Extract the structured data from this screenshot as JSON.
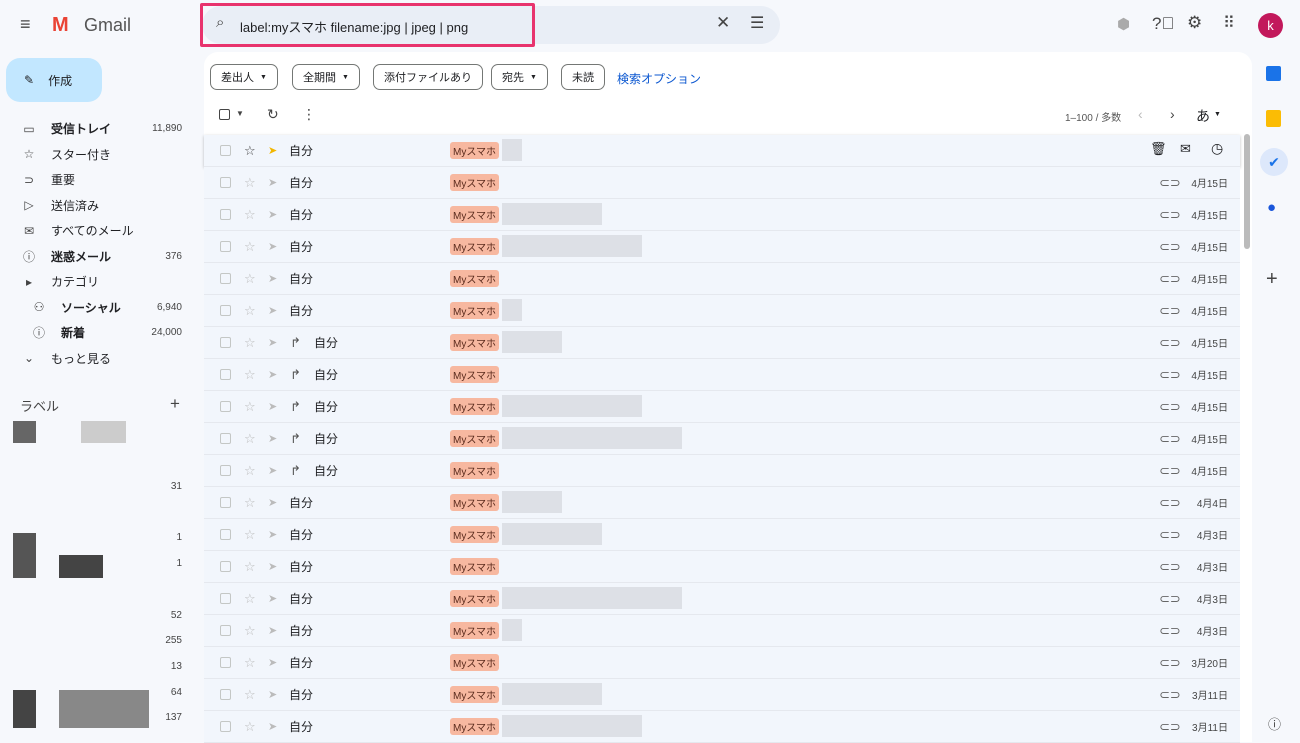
{
  "app": {
    "name": "Gmail",
    "avatar": "k"
  },
  "search": {
    "query": "label:myスマホ filename:jpg | jpeg | png"
  },
  "compose": "作成",
  "nav": [
    {
      "icon": "inbox-icon",
      "glyph": "▭",
      "label": "受信トレイ",
      "count": "11,890",
      "bold": true
    },
    {
      "icon": "star-icon",
      "glyph": "☆",
      "label": "スター付き",
      "count": ""
    },
    {
      "icon": "important-icon",
      "glyph": "⊃",
      "label": "重要",
      "count": ""
    },
    {
      "icon": "sent-icon",
      "glyph": "▷",
      "label": "送信済み",
      "count": ""
    },
    {
      "icon": "all-mail-icon",
      "glyph": "✉",
      "label": "すべてのメール",
      "count": ""
    },
    {
      "icon": "spam-icon",
      "glyph": "ⓘ",
      "label": "迷惑メール",
      "count": "376",
      "bold": true
    },
    {
      "icon": "category-icon",
      "glyph": "▸",
      "label": "カテゴリ",
      "count": ""
    },
    {
      "icon": "social-icon",
      "glyph": "⚇",
      "label": "ソーシャル",
      "count": "6,940",
      "bold": true,
      "indent": true
    },
    {
      "icon": "updates-icon",
      "glyph": "ⓘ",
      "label": "新着",
      "count": "24,000",
      "bold": true,
      "indent": true
    },
    {
      "icon": "chevron-down-icon",
      "glyph": "⌄",
      "label": "もっと見る",
      "count": ""
    }
  ],
  "labels": {
    "title": "ラベル",
    "counts": [
      "31",
      "1",
      "1",
      "52",
      "255",
      "13",
      "64",
      "137"
    ]
  },
  "filters": [
    "差出人",
    "全期間",
    "添付ファイルあり",
    "宛先",
    "未読"
  ],
  "search_options": "検索オプション",
  "pagination": "1–100 / 多数",
  "input_tool": "あ",
  "rows": [
    {
      "sender": "自分",
      "tag": "Myスマホ",
      "date": "",
      "fw": false,
      "hover": true
    },
    {
      "sender": "自分",
      "tag": "Myスマホ",
      "date": "4月15日",
      "fw": false
    },
    {
      "sender": "自分",
      "tag": "Myスマホ",
      "date": "4月15日",
      "fw": false
    },
    {
      "sender": "自分",
      "tag": "Myスマホ",
      "date": "4月15日",
      "fw": false
    },
    {
      "sender": "自分",
      "tag": "Myスマホ",
      "date": "4月15日",
      "fw": false
    },
    {
      "sender": "自分",
      "tag": "Myスマホ",
      "date": "4月15日",
      "fw": false
    },
    {
      "sender": "自分",
      "tag": "Myスマホ",
      "date": "4月15日",
      "fw": true
    },
    {
      "sender": "自分",
      "tag": "Myスマホ",
      "date": "4月15日",
      "fw": true
    },
    {
      "sender": "自分",
      "tag": "Myスマホ",
      "date": "4月15日",
      "fw": true
    },
    {
      "sender": "自分",
      "tag": "Myスマホ",
      "date": "4月15日",
      "fw": true
    },
    {
      "sender": "自分",
      "tag": "Myスマホ",
      "date": "4月15日",
      "fw": true
    },
    {
      "sender": "自分",
      "tag": "Myスマホ",
      "date": "4月4日",
      "fw": false
    },
    {
      "sender": "自分",
      "tag": "Myスマホ",
      "date": "4月3日",
      "fw": false
    },
    {
      "sender": "自分",
      "tag": "Myスマホ",
      "date": "4月3日",
      "fw": false
    },
    {
      "sender": "自分",
      "tag": "Myスマホ",
      "date": "4月3日",
      "fw": false
    },
    {
      "sender": "自分",
      "tag": "Myスマホ",
      "date": "4月3日",
      "fw": false
    },
    {
      "sender": "自分",
      "tag": "Myスマホ",
      "date": "3月20日",
      "fw": false
    },
    {
      "sender": "自分",
      "tag": "Myスマホ",
      "date": "3月11日",
      "fw": false
    },
    {
      "sender": "自分",
      "tag": "Myスマホ",
      "date": "3月11日",
      "fw": false
    }
  ]
}
